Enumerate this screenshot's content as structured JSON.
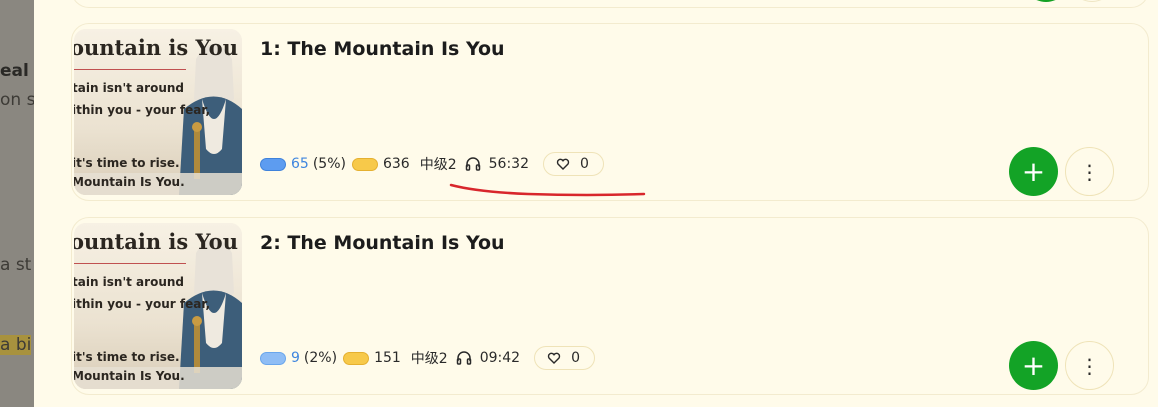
{
  "backdrop": {
    "lines": [
      "eal S",
      "on st",
      "a st",
      "a bi"
    ]
  },
  "lessons": [
    {
      "title": "1: The Mountain Is You",
      "thumbnail": {
        "heading": "ountain is You",
        "line1": "tain isn't around",
        "line2": "ithin you - your fear,",
        "line3": "it's time to rise.",
        "brand": " Mountain Is You."
      },
      "known_words": "65",
      "known_pct": "(5%)",
      "lingqs": "636",
      "level": "中级2",
      "duration": "56:32",
      "likes": "0"
    },
    {
      "title": "2: The Mountain Is You",
      "thumbnail": {
        "heading": "ountain is You",
        "line1": "tain isn't around",
        "line2": "ithin you - your fear,",
        "line3": "it's time to rise.",
        "brand": " Mountain Is You."
      },
      "known_words": "9",
      "known_pct": "(2%)",
      "lingqs": "151",
      "level": "中级2",
      "duration": "09:42",
      "likes": "0"
    }
  ],
  "buttons": {
    "add_label": "+",
    "more_label": "⋮"
  },
  "icons": {
    "headphones": "headphones-icon",
    "like": "heart-icon",
    "add": "plus-icon",
    "more": "more-vertical-icon"
  },
  "colors": {
    "panel": "#fffbea",
    "add_button": "#13a326",
    "known_blue": "#3f86df",
    "annotation": "#d8262c"
  }
}
